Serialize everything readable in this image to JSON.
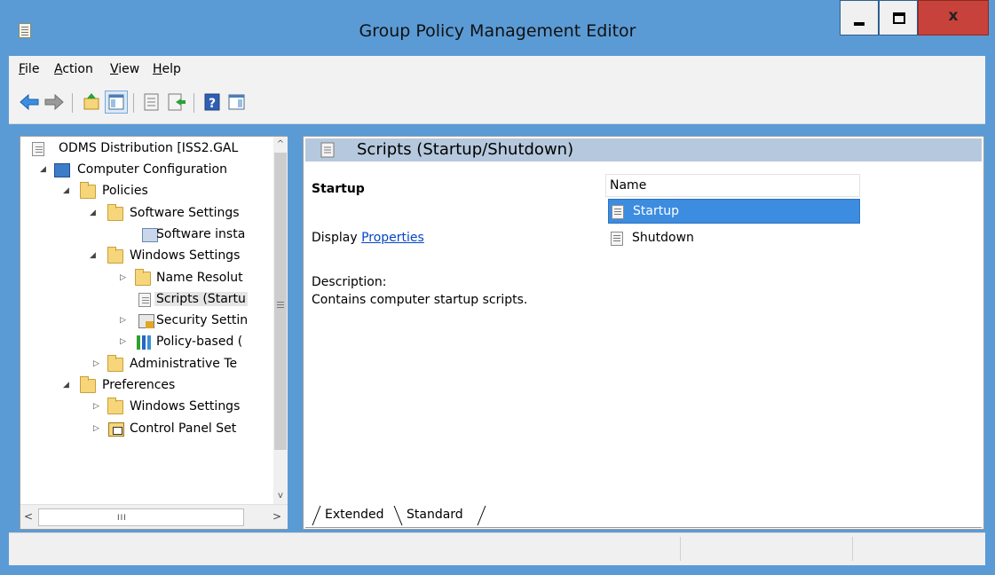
{
  "window": {
    "title": "Group Policy Management Editor",
    "close_label": "x",
    "accent": "#5b9bd5"
  },
  "menu": {
    "items": [
      {
        "label_rest": "ile",
        "access_key": "F"
      },
      {
        "label_rest": "ction",
        "access_key": "A"
      },
      {
        "label_rest": "iew",
        "access_key": "V"
      },
      {
        "label_rest": "elp",
        "access_key": "H"
      }
    ]
  },
  "toolbar": {
    "icons": [
      "back-arrow-icon",
      "forward-arrow-icon",
      "up-folder-icon",
      "show-hide-console-tree-icon",
      "properties-icon",
      "export-list-icon",
      "help-icon",
      "show-hide-action-pane-icon"
    ]
  },
  "tree": {
    "items": [
      {
        "label": "ODMS Distribution [ISS2.GAL",
        "icon": "policy-doc-icon",
        "expander": ""
      },
      {
        "label": "Computer Configuration",
        "icon": "computer-icon",
        "expander": "◢"
      },
      {
        "label": "Policies",
        "icon": "folder-icon",
        "expander": "◢"
      },
      {
        "label": "Software Settings",
        "icon": "folder-icon",
        "expander": "◢"
      },
      {
        "label": "Software insta",
        "icon": "software-install-icon",
        "expander": ""
      },
      {
        "label": "Windows Settings",
        "icon": "folder-icon",
        "expander": "◢"
      },
      {
        "label": "Name Resolut",
        "icon": "folder-icon",
        "expander": "▷"
      },
      {
        "label": "Scripts (Startu",
        "icon": "script-icon",
        "expander": ""
      },
      {
        "label": "Security Settin",
        "icon": "security-settings-icon",
        "expander": "▷"
      },
      {
        "label": "Policy-based (",
        "icon": "qos-bars-icon",
        "expander": "▷"
      },
      {
        "label": "Administrative Te",
        "icon": "folder-icon",
        "expander": "▷"
      },
      {
        "label": "Preferences",
        "icon": "folder-icon",
        "expander": "◢"
      },
      {
        "label": "Windows Settings",
        "icon": "folder-icon",
        "expander": "▷"
      },
      {
        "label": "Control Panel Set",
        "icon": "control-panel-icon",
        "expander": "▷"
      }
    ],
    "scroll_up": "^",
    "scroll_down": "v",
    "hscroll_left": "<",
    "hscroll_right": ">",
    "hscroll_grip": "III"
  },
  "main": {
    "header_title": "Scripts (Startup/Shutdown)",
    "extended": {
      "heading": "Startup",
      "display_prefix": "Display ",
      "display_link": "Properties",
      "description_label": "Description:",
      "description_text": "Contains computer startup scripts."
    },
    "list": {
      "column_header": "Name",
      "items": [
        {
          "label": "Startup",
          "selected": true
        },
        {
          "label": "Shutdown",
          "selected": false
        }
      ]
    },
    "tabs": [
      {
        "label": "Extended",
        "active": true
      },
      {
        "label": "Standard",
        "active": false
      }
    ]
  },
  "colors": {
    "selection": "#3c8ce0",
    "header_band": "#b6c8dd",
    "link": "#0645c8"
  }
}
